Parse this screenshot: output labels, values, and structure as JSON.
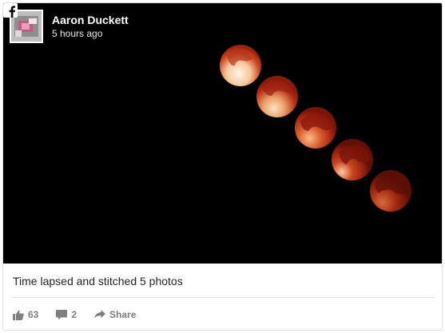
{
  "post": {
    "author_name": "Aaron Duckett",
    "timestamp": "5 hours ago",
    "caption": "Time lapsed and stitched 5 photos",
    "platform_icon": "facebook-icon",
    "image_subject": "lunar eclipse time-lapse, 5 blood moons"
  },
  "actions": {
    "like_count": "63",
    "comment_count": "2",
    "share_label": "Share"
  },
  "colors": {
    "background": "#000000",
    "moon_dark": "#8a1a0c",
    "moon_bright": "#ffe6c8",
    "action_gray": "#7f7f7f"
  }
}
